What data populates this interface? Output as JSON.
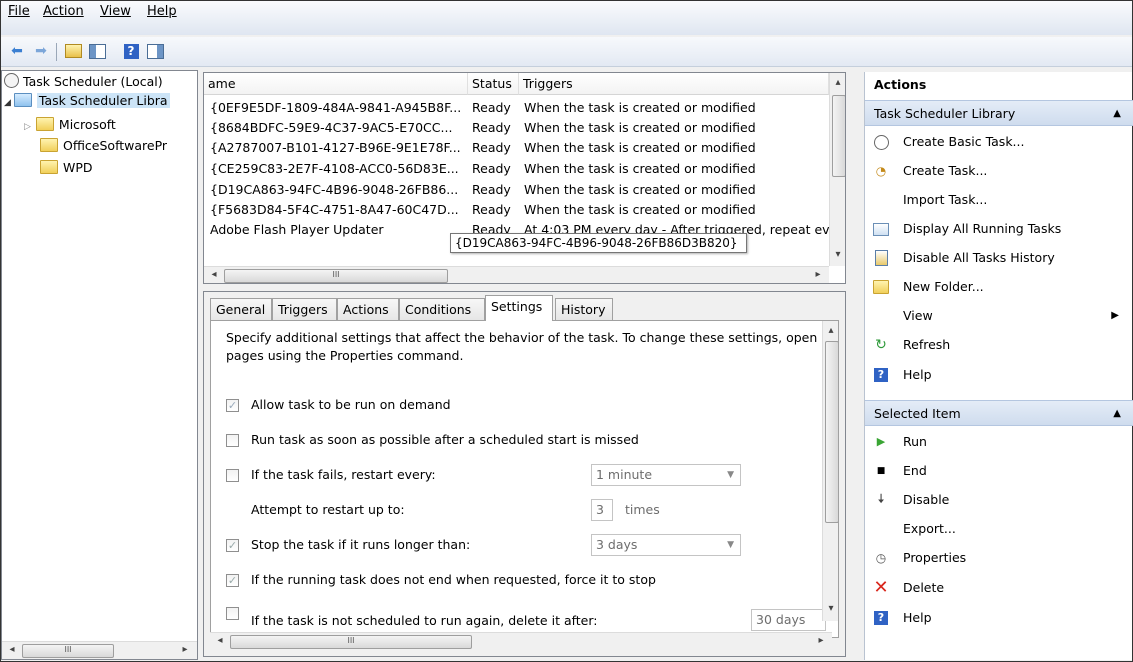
{
  "menu": [
    "File",
    "Action",
    "View",
    "Help"
  ],
  "tree": {
    "root": "Task Scheduler (Local)",
    "library": "Task Scheduler Libra",
    "folders": [
      "Microsoft",
      "OfficeSoftwarePr",
      "WPD"
    ]
  },
  "tasklist": {
    "columns": [
      "ame",
      "Status",
      "Triggers"
    ],
    "rows": [
      {
        "name": "{0EF9E5DF-1809-484A-9841-A945B8F...",
        "status": "Ready",
        "trigger": "When the task is created or modified"
      },
      {
        "name": "{8684BDFC-59E9-4C37-9AC5-E70CC...",
        "status": "Ready",
        "trigger": "When the task is created or modified"
      },
      {
        "name": "{A2787007-B101-4127-B96E-9E1E78F...",
        "status": "Ready",
        "trigger": "When the task is created or modified"
      },
      {
        "name": "{CE259C83-2E7F-4108-ACC0-56D83E...",
        "status": "Ready",
        "trigger": "When the task is created or modified"
      },
      {
        "name": "{D19CA863-94FC-4B96-9048-26FB86...",
        "status": "Ready",
        "trigger": "When the task is created or modified"
      },
      {
        "name": "{F5683D84-5F4C-4751-8A47-60C47D...",
        "status": "Ready",
        "trigger": "When the task is created or modified"
      },
      {
        "name": "Adobe Flash Player Updater",
        "status": "Ready",
        "trigger": "At 4:03 PM every day - After triggered, repeat ev"
      }
    ],
    "tooltip": "{D19CA863-94FC-4B96-9048-26FB86D3B820}"
  },
  "tabs": [
    "General",
    "Triggers",
    "Actions",
    "Conditions",
    "Settings",
    "History"
  ],
  "active_tab": "Settings",
  "settings": {
    "intro": "Specify additional settings that affect the behavior of the task. To change these settings, open",
    "intro2": "pages using the Properties command.",
    "allow_demand": "Allow task to be run on demand",
    "run_missed": "Run task as soon as possible after a scheduled start is missed",
    "restart_every": "If the task fails, restart every:",
    "restart_every_value": "1 minute",
    "attempt_restart": "Attempt to restart up to:",
    "attempt_value": "3",
    "attempt_unit": "times",
    "stop_longer": "Stop the task if it runs longer than:",
    "stop_longer_value": "3 days",
    "force_stop": "If the running task does not end when requested, force it to stop",
    "delete_after": "If the task is not scheduled to run again, delete it after:",
    "delete_after_value": "30 days"
  },
  "actions": {
    "title": "Actions",
    "section1": "Task Scheduler Library",
    "items1": [
      "Create Basic Task...",
      "Create Task...",
      "Import Task...",
      "Display All Running Tasks",
      "Disable All Tasks History",
      "New Folder...",
      "View",
      "Refresh",
      "Help"
    ],
    "section2": "Selected Item",
    "items2": [
      "Run",
      "End",
      "Disable",
      "Export...",
      "Properties",
      "Delete",
      "Help"
    ]
  },
  "colors": {
    "selection": "#cce4f7",
    "section_header": "#d6e2f1",
    "delete_red": "#d9261c",
    "run_green": "#3aa534"
  }
}
